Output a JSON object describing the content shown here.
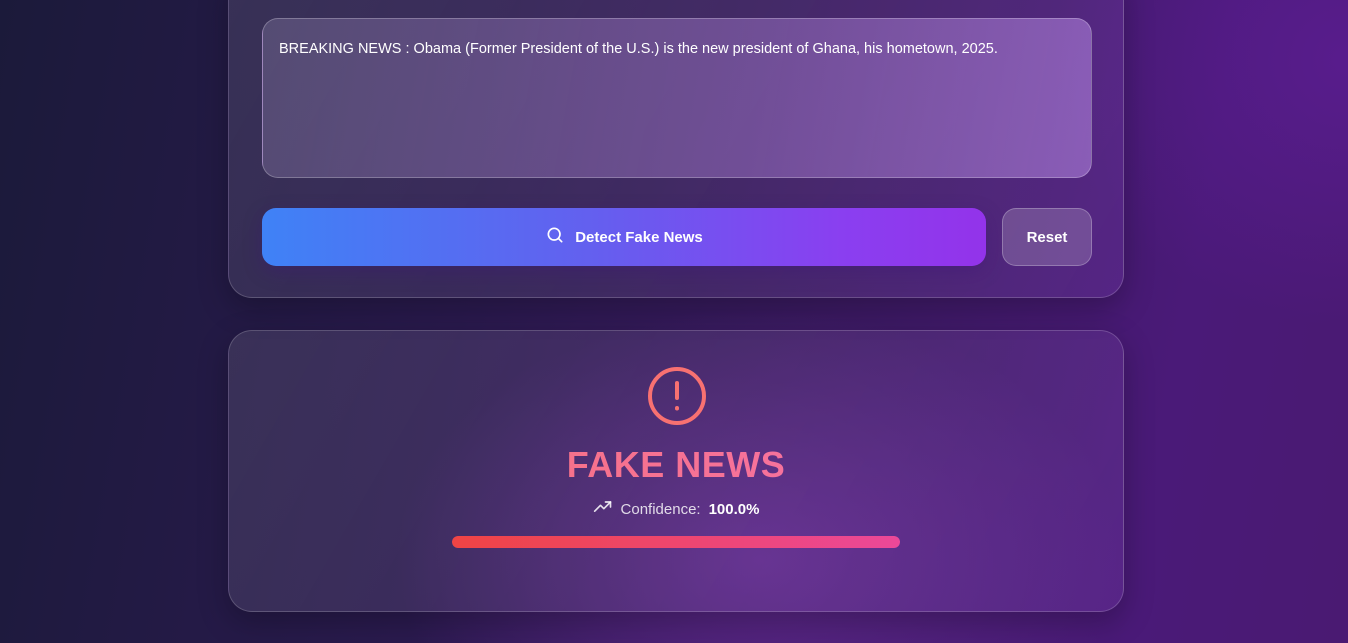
{
  "input": {
    "text": "BREAKING NEWS : Obama (Former President of the U.S.) is the new president of Ghana, his hometown, 2025."
  },
  "actions": {
    "detect_label": "Detect Fake News",
    "detect_icon": "search-icon",
    "reset_label": "Reset"
  },
  "result": {
    "icon": "alert-circle-icon",
    "label": "FAKE NEWS",
    "confidence_icon": "trending-up-icon",
    "confidence_label": "Confidence:",
    "confidence_value": "100.0%",
    "confidence_fraction": 1.0
  },
  "colors": {
    "fake_accent": "#f87171",
    "button_start": "#3f82f6",
    "button_end": "#9333ea"
  }
}
